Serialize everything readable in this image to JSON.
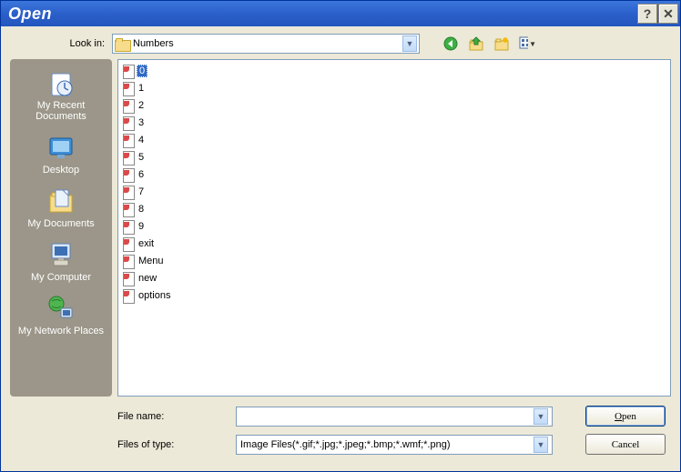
{
  "title": "Open",
  "toolbar": {
    "lookin_label": "Look in:",
    "lookin_value": "Numbers"
  },
  "places": [
    {
      "id": "recent",
      "label": "My Recent Documents"
    },
    {
      "id": "desktop",
      "label": "Desktop"
    },
    {
      "id": "mydocs",
      "label": "My Documents"
    },
    {
      "id": "mycomputer",
      "label": "My Computer"
    },
    {
      "id": "network",
      "label": "My Network Places"
    }
  ],
  "files": [
    {
      "name": "0",
      "selected": true
    },
    {
      "name": "1"
    },
    {
      "name": "2"
    },
    {
      "name": "3"
    },
    {
      "name": "4"
    },
    {
      "name": "5"
    },
    {
      "name": "6"
    },
    {
      "name": "7"
    },
    {
      "name": "8"
    },
    {
      "name": "9"
    },
    {
      "name": "exit"
    },
    {
      "name": "Menu"
    },
    {
      "name": "new"
    },
    {
      "name": "options"
    }
  ],
  "bottom": {
    "filename_label": "File name:",
    "filename_value": "",
    "filetype_label": "Files of type:",
    "filetype_value": "Image Files(*.gif;*.jpg;*.jpeg;*.bmp;*.wmf;*.png)",
    "open_label": "Open",
    "cancel_label": "Cancel"
  }
}
